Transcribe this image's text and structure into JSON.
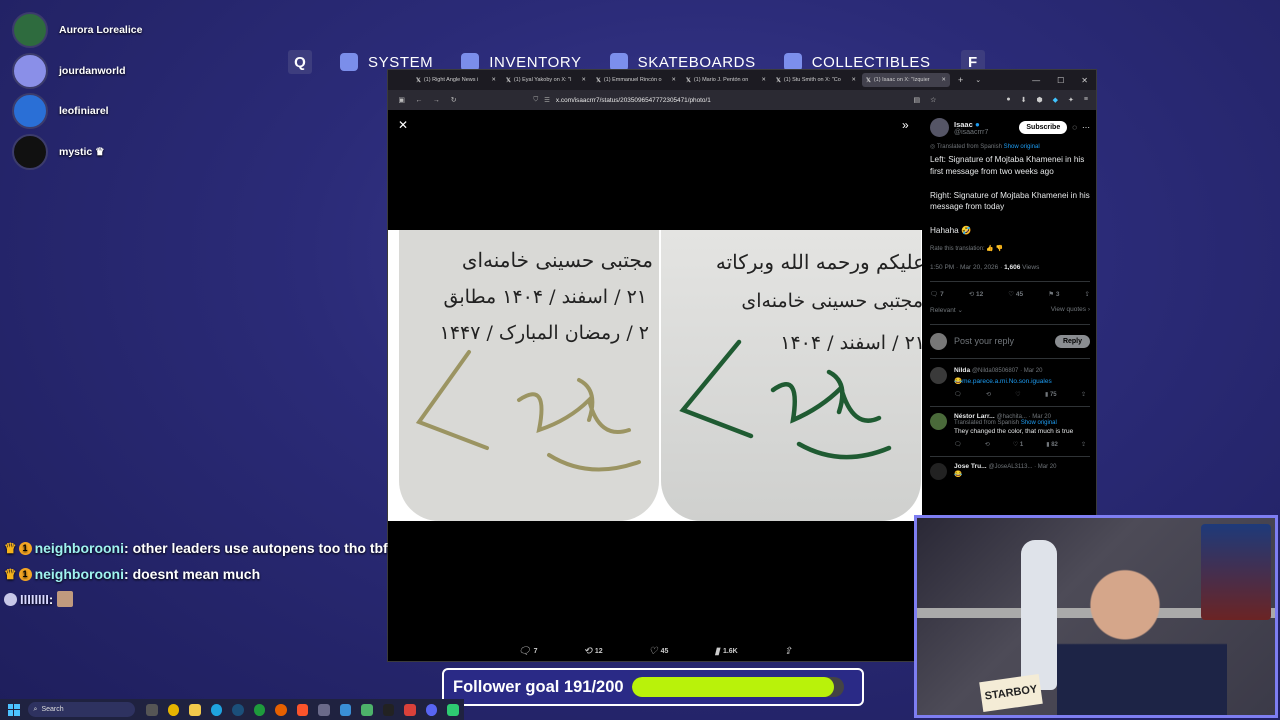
{
  "voice_users": [
    {
      "name": "Aurora Lorealice",
      "color": "#2e6b3e"
    },
    {
      "name": "jourdanworld",
      "color": "#8a8fe8"
    },
    {
      "name": "leofiniarel",
      "color": "#2a6fd6"
    },
    {
      "name": "mystic ♛",
      "color": "#111111"
    }
  ],
  "game_menu": {
    "left_key": "Q",
    "right_key": "F",
    "items": [
      "SYSTEM",
      "INVENTORY",
      "SKATEBOARDS",
      "COLLECTIBLES"
    ]
  },
  "browser": {
    "tabs": [
      {
        "title": "(1) Right Angle News i",
        "active": false
      },
      {
        "title": "(1) Eyal Yakoby on X: \"I",
        "active": false
      },
      {
        "title": "(1) Emmanuel Rincón o",
        "active": false
      },
      {
        "title": "(1) Mario J. Pentón on",
        "active": false
      },
      {
        "title": "(1) Stu Smith on X: \"Co",
        "active": false
      },
      {
        "title": "(1) Isaac on X: \"Izquier",
        "active": true
      }
    ],
    "url": "x.com/isaacrrr7/status/2035096547772305471/photo/1"
  },
  "photo": {
    "left_lines": [
      "مجتبی حسینی خامنه‌ای",
      "۲۱ / اسفند / ۱۴۰۴ مطابق",
      "۲ / رمضان المبارک / ۱۴۴۷"
    ],
    "right_lines": [
      "علیکم ورحمه الله وبرکاته",
      "مجتبی حسینی خامنه‌ای",
      "۲۱ / اسفند / ۱۴۰۴"
    ]
  },
  "viewer_actions": {
    "replies": "7",
    "reposts": "12",
    "likes": "45",
    "views": "1.6K"
  },
  "tweet": {
    "author_name": "Isaac",
    "author_handle": "@isaacrrr7",
    "subscribe": "Subscribe",
    "translated_note": "Translated from Spanish",
    "show_original": "Show original",
    "paragraph1": "Left: Signature of Mojtaba Khamenei in his first message from two weeks ago",
    "paragraph2": "Right: Signature of Mojtaba Khamenei in his message from today",
    "paragraph3": "Hahaha 🤣",
    "rate": "Rate this translation:",
    "timestamp": "1:50 PM · Mar 20, 2026 · ",
    "views_count": "1,606",
    "views_label": " Views",
    "stats": {
      "replies": "7",
      "reposts": "12",
      "likes": "45",
      "bookmarks": "3"
    },
    "sort": "Relevant ⌄",
    "view_quotes": "View quotes ›",
    "reply_placeholder": "Post your reply",
    "reply_button": "Reply"
  },
  "comments": [
    {
      "name": "Nilda",
      "handle": "@Nilda08506807 · Mar 20",
      "text": "😂me.parece.a.mi.No.son.iguales",
      "likes": "",
      "views": "75"
    },
    {
      "name": "Néstor Larr...",
      "handle": "@hachita... · Mar 20",
      "note": "Translated from Spanish",
      "show": "Show original",
      "text": "They changed the color, that much is true",
      "likes": "1",
      "views": "82"
    },
    {
      "name": "Jose Tru...",
      "handle": "@JoseAL3113... · Mar 20",
      "text": "😂"
    }
  ],
  "chat": [
    {
      "user": "neighborooni",
      "message": "other leaders use autopens too tho tbf"
    },
    {
      "user": "neighborooni",
      "message": "doesnt mean much"
    },
    {
      "user": "IIIIIIII",
      "message": ""
    }
  ],
  "follower_goal": {
    "label": "Follower goal 191/200",
    "current": 191,
    "target": 200,
    "bar_color": "#b9f20a"
  },
  "webcam": {
    "sign_text": "STARBOY"
  },
  "taskbar": {
    "search": "Search"
  }
}
